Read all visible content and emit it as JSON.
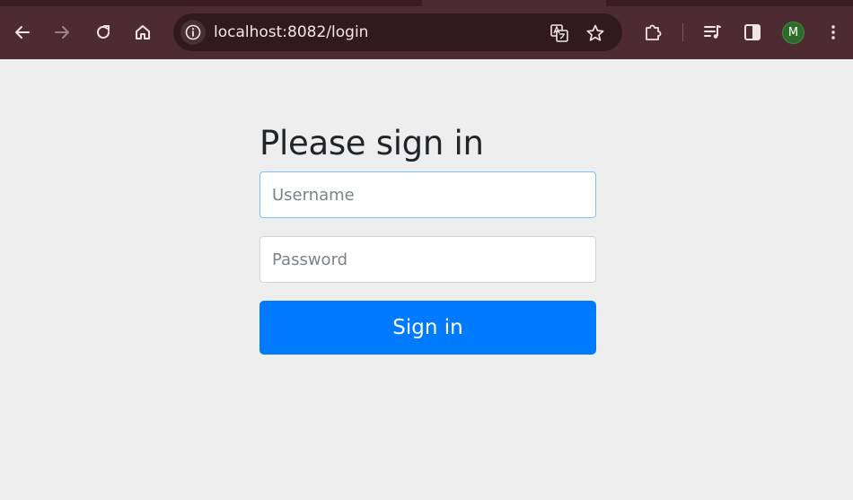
{
  "browser": {
    "url": "localhost:8082/login",
    "profile_initial": "M",
    "icons": {
      "back": "arrow-left-icon",
      "forward": "arrow-right-icon",
      "reload": "reload-icon",
      "home": "home-icon",
      "site_info": "info-icon",
      "translate": "translate-icon",
      "bookmark": "star-icon",
      "extensions": "puzzle-icon",
      "media": "media-queue-icon",
      "side_panel": "side-panel-icon",
      "menu": "kebab-menu-icon"
    },
    "colors": {
      "toolbar": "#4d2b33",
      "omnibox": "#301a1f",
      "avatar": "#2e6b2a"
    }
  },
  "page": {
    "heading": "Please sign in",
    "username_placeholder": "Username",
    "username_value": "",
    "password_placeholder": "Password",
    "password_value": "",
    "submit_label": "Sign in",
    "colors": {
      "background": "#eeeeee",
      "primary": "#007bff",
      "focus_border": "#80bdff"
    }
  }
}
